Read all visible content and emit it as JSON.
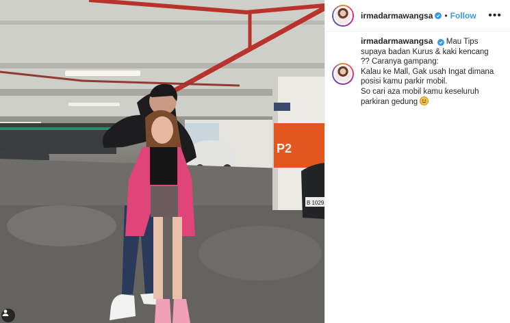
{
  "post": {
    "username": "irmadarmawangsa",
    "follow_label": "Follow",
    "separator": "•",
    "more_label": "•••",
    "caption": {
      "username": "irmadarmawangsa",
      "lines": [
        "Mau Tips",
        "supaya badan Kurus & kaki kencang",
        "?? Caranya gampang:",
        "Kalau ke Mall, Gak usah Ingat dimana",
        "posisi kamu parkir mobil.",
        "So cari aza mobil kamu keseluruh",
        "parkiran gedung"
      ]
    },
    "photo": {
      "pillar_sign": "P2",
      "plate_text": "B 1029"
    }
  },
  "colors": {
    "accent_blue": "#3897f0",
    "pillar_orange": "#e2571f",
    "pipe_red": "#b8332b"
  }
}
